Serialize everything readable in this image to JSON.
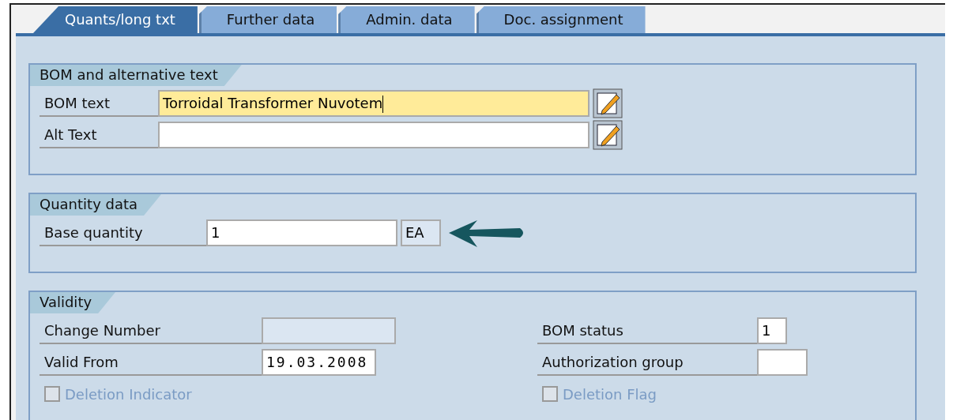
{
  "tabs": [
    {
      "label": "Quants/long txt",
      "selected": true
    },
    {
      "label": "Further data",
      "selected": false
    },
    {
      "label": "Admin. data",
      "selected": false
    },
    {
      "label": "Doc. assignment",
      "selected": false
    }
  ],
  "bom_text_group": {
    "title": "BOM and alternative text",
    "rows": [
      {
        "label": "BOM text",
        "value": "Torroidal Transformer Nuvotem",
        "focused": true
      },
      {
        "label": "Alt Text",
        "focused": false
      }
    ]
  },
  "quantity_group": {
    "title": "Quantity data",
    "label": "Base quantity",
    "value": "1",
    "unit": "EA"
  },
  "validity_group": {
    "title": "Validity",
    "left": [
      {
        "label": "Change Number",
        "disabled": true
      },
      {
        "label": "Valid From",
        "value": "19.03.2008",
        "disabled": false
      }
    ],
    "right": [
      {
        "label": "BOM status",
        "value": "1",
        "disabled": false
      },
      {
        "label": "Authorization group",
        "disabled": false
      }
    ],
    "checkboxes": [
      {
        "label": "Deletion Indicator",
        "checked": false,
        "disabled": true
      },
      {
        "label": "Deletion Flag",
        "checked": false,
        "disabled": true
      }
    ]
  }
}
